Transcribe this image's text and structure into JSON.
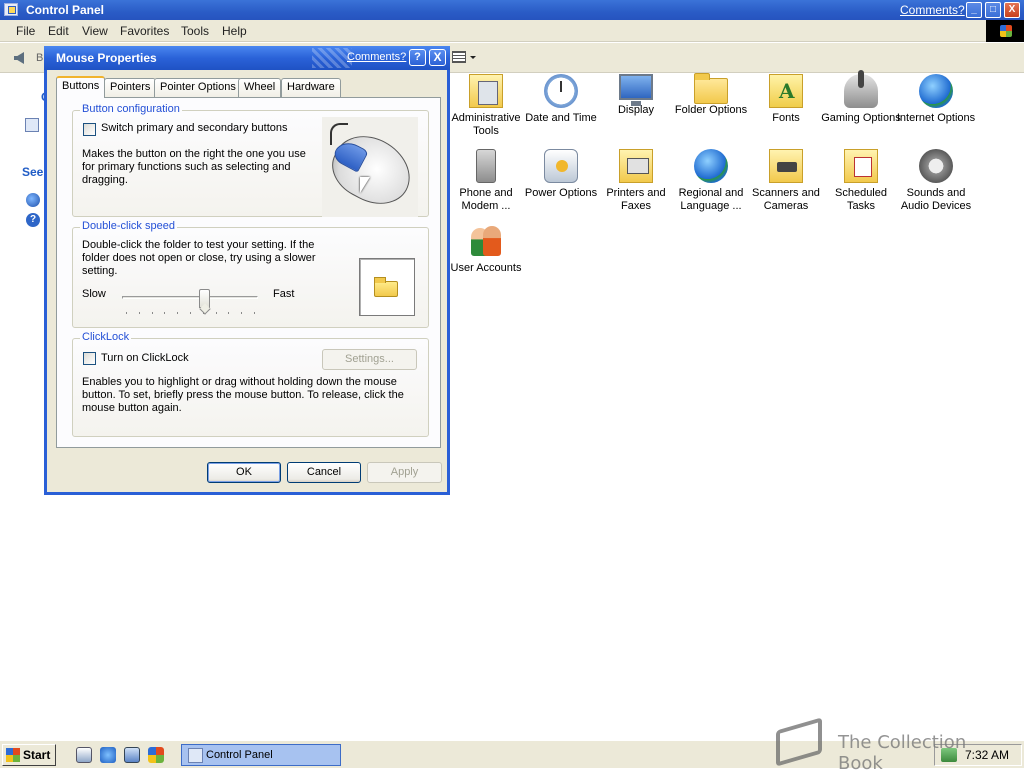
{
  "window": {
    "title": "Control Panel",
    "comments_link": "Comments?",
    "controls": [
      "_",
      "□",
      "X"
    ]
  },
  "menubar": [
    "File",
    "Edit",
    "View",
    "Favorites",
    "Tools",
    "Help"
  ],
  "toolbar": {
    "back_label": "B"
  },
  "left_pane": {
    "section_cut": "C",
    "see_also": "See"
  },
  "icons": [
    {
      "label": "Administrative Tools",
      "icon": "admin-tools-icon"
    },
    {
      "label": "Date and Time",
      "icon": "clock-icon"
    },
    {
      "label": "Display",
      "icon": "display-icon"
    },
    {
      "label": "Folder Options",
      "icon": "folder-options-icon"
    },
    {
      "label": "Fonts",
      "icon": "fonts-icon"
    },
    {
      "label": "Gaming Options",
      "icon": "joystick-icon"
    },
    {
      "label": "Internet Options",
      "icon": "globe-icon"
    },
    {
      "label": "Phone and Modem ...",
      "icon": "phone-icon"
    },
    {
      "label": "Power Options",
      "icon": "power-icon"
    },
    {
      "label": "Printers and Faxes",
      "icon": "printer-icon"
    },
    {
      "label": "Regional and Language ...",
      "icon": "regional-globe-icon"
    },
    {
      "label": "Scanners and Cameras",
      "icon": "scanner-icon"
    },
    {
      "label": "Scheduled Tasks",
      "icon": "scheduled-tasks-icon"
    },
    {
      "label": "Sounds and Audio Devices",
      "icon": "speaker-icon"
    },
    {
      "label": "User Accounts",
      "icon": "users-icon"
    }
  ],
  "dialog": {
    "title": "Mouse Properties",
    "comments_link": "Comments?",
    "help_glyph": "?",
    "close_glyph": "X",
    "tabs": [
      "Buttons",
      "Pointers",
      "Pointer Options",
      "Wheel",
      "Hardware"
    ],
    "active_tab": "Buttons",
    "button_config": {
      "legend": "Button configuration",
      "checkbox_label": "Switch primary and secondary buttons",
      "checked": false,
      "description": "Makes the button on the right the one you use for primary functions such as selecting and dragging."
    },
    "double_click": {
      "legend": "Double-click speed",
      "description": "Double-click the folder to test your setting. If the folder does not open or close, try using a slower setting.",
      "slow_label": "Slow",
      "fast_label": "Fast",
      "speed_fraction": 0.6,
      "tick_count": 11
    },
    "clicklock": {
      "legend": "ClickLock",
      "checkbox_label": "Turn on ClickLock",
      "checked": false,
      "settings_button": "Settings...",
      "description": "Enables you to highlight or drag without holding down the mouse button. To set, briefly press the mouse button. To release, click the mouse button again."
    },
    "buttons": {
      "ok": "OK",
      "cancel": "Cancel",
      "apply": "Apply"
    }
  },
  "taskbar": {
    "start_label": "Start",
    "task_label": "Control Panel",
    "clock": "7:32 AM"
  },
  "watermark": {
    "text": "The Collection Book"
  }
}
